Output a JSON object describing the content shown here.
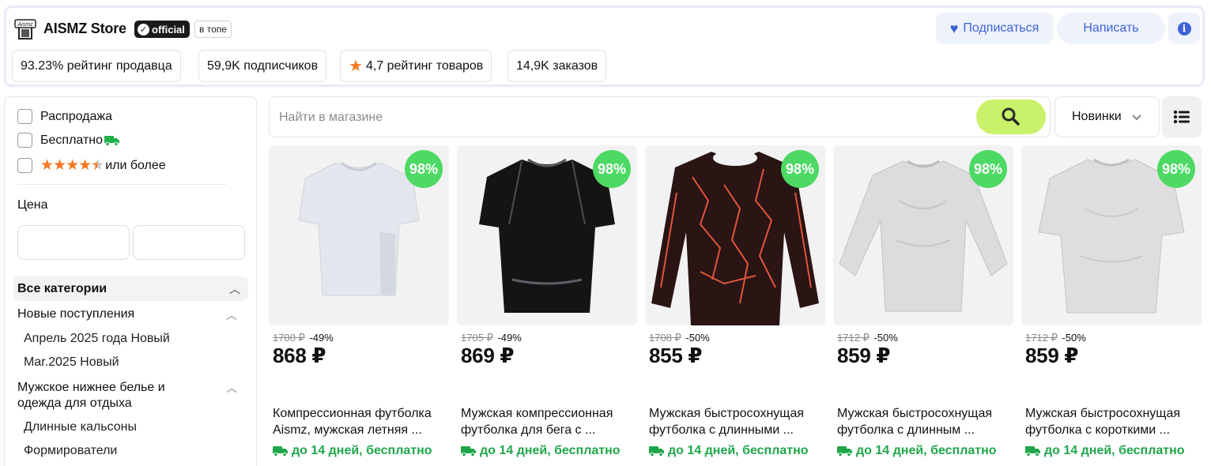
{
  "store": {
    "name": "AISMZ Store",
    "official_label": "official",
    "top_badge": "в топе",
    "logo_text": "Aismz"
  },
  "stats": [
    {
      "text": "93.23% рейтинг продавца"
    },
    {
      "text": "59,9K подписчиков"
    },
    {
      "text": "4,7 рейтинг товаров"
    },
    {
      "text": "14,9K заказов"
    }
  ],
  "actions": {
    "subscribe": "Подписаться",
    "write": "Написать",
    "info_icon": "info-icon"
  },
  "filters": {
    "sale": "Распродажа",
    "free_delivery": "Бесплатно",
    "rating": "или более",
    "rating_stars": 4.5,
    "price_label": "Цена",
    "price_from": "",
    "price_to": ""
  },
  "categories": {
    "all": "Все категории",
    "new_arrivals": "Новые поступления",
    "new_sub": [
      "Апрель 2025 года Новый",
      "Mar.2025 Новый"
    ],
    "mens": "Мужское нижнее белье и одежда для отдыха",
    "mens_sub": [
      "Длинные кальсоны",
      "Формирователи"
    ]
  },
  "search": {
    "placeholder": "Найти в магазине",
    "value": "",
    "sort": "Новинки"
  },
  "products": [
    {
      "rating": "98%",
      "old_price": "1700 ₽",
      "discount": "-49%",
      "price": "868 ₽",
      "title": "Компрессионная футболка Aismz, мужская летняя ...",
      "delivery": "до 14 дней, бесплатно"
    },
    {
      "rating": "98%",
      "old_price": "1705 ₽",
      "discount": "-49%",
      "price": "869 ₽",
      "title": "Мужская компрессионная футболка для бега с ...",
      "delivery": "до 14 дней, бесплатно"
    },
    {
      "rating": "98%",
      "old_price": "1708 ₽",
      "discount": "-50%",
      "price": "855 ₽",
      "title": "Мужская быстросохнущая футболка с длинными ...",
      "delivery": "до 14 дней, бесплатно"
    },
    {
      "rating": "98%",
      "old_price": "1712 ₽",
      "discount": "-50%",
      "price": "859 ₽",
      "title": "Мужская быстросохнущая футболка с длинным ...",
      "delivery": "до 14 дней, бесплатно"
    },
    {
      "rating": "98%",
      "old_price": "1712 ₽",
      "discount": "-50%",
      "price": "859 ₽",
      "title": "Мужская быстросохнущая футболка с короткими ...",
      "delivery": "до 14 дней, бесплатно"
    }
  ],
  "colors": {
    "accent": "#3d63d6",
    "search_button": "#c9f169",
    "rating_badge": "#4cd964",
    "delivery_green": "#20a64a",
    "star_orange": "#f5771f"
  }
}
